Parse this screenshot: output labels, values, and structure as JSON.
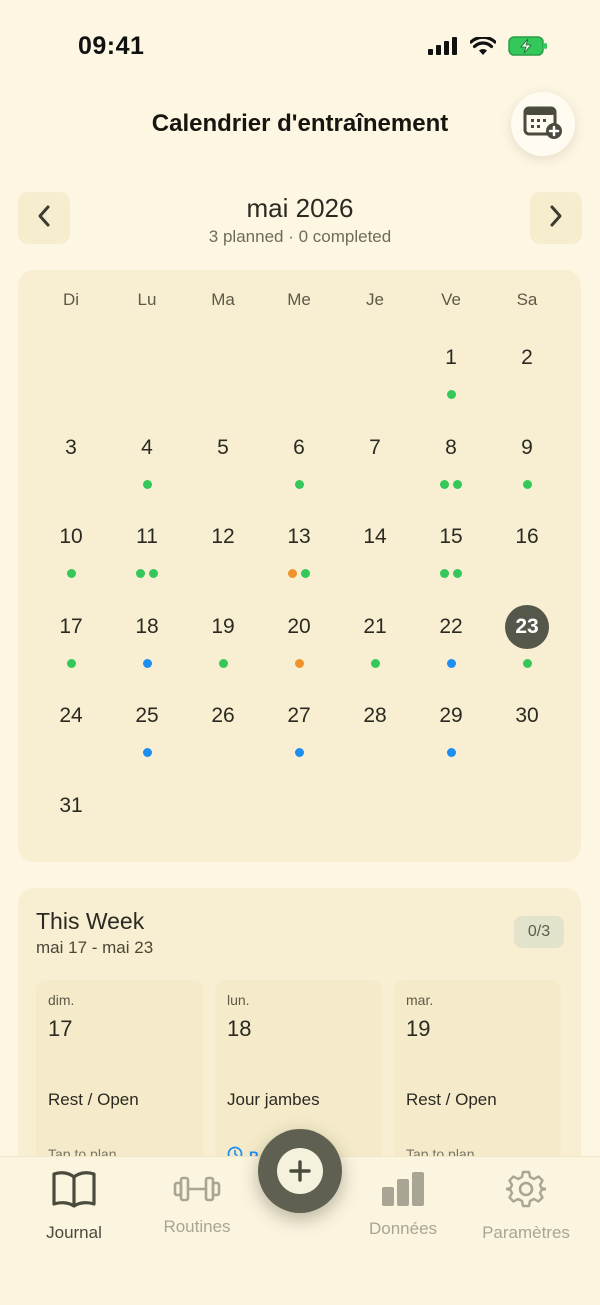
{
  "status_bar": {
    "time": "09:41"
  },
  "header": {
    "title": "Calendrier d'entraînement"
  },
  "month": {
    "title": "mai 2026",
    "subtitle": "3 planned · 0 completed"
  },
  "calendar": {
    "weekdays": [
      "Di",
      "Lu",
      "Ma",
      "Me",
      "Je",
      "Ve",
      "Sa"
    ],
    "today": "23",
    "weeks": [
      [
        null,
        null,
        null,
        null,
        null,
        {
          "day": "1",
          "dots": [
            "green"
          ]
        },
        {
          "day": "2",
          "dots": []
        }
      ],
      [
        {
          "day": "3",
          "dots": []
        },
        {
          "day": "4",
          "dots": [
            "green"
          ]
        },
        {
          "day": "5",
          "dots": []
        },
        {
          "day": "6",
          "dots": [
            "green"
          ]
        },
        {
          "day": "7",
          "dots": []
        },
        {
          "day": "8",
          "dots": [
            "green",
            "green"
          ]
        },
        {
          "day": "9",
          "dots": [
            "green"
          ]
        }
      ],
      [
        {
          "day": "10",
          "dots": [
            "green"
          ]
        },
        {
          "day": "11",
          "dots": [
            "green",
            "green"
          ]
        },
        {
          "day": "12",
          "dots": []
        },
        {
          "day": "13",
          "dots": [
            "orange",
            "green"
          ]
        },
        {
          "day": "14",
          "dots": []
        },
        {
          "day": "15",
          "dots": [
            "green",
            "green"
          ]
        },
        {
          "day": "16",
          "dots": []
        }
      ],
      [
        {
          "day": "17",
          "dots": [
            "green"
          ]
        },
        {
          "day": "18",
          "dots": [
            "blue"
          ]
        },
        {
          "day": "19",
          "dots": [
            "green"
          ]
        },
        {
          "day": "20",
          "dots": [
            "orange"
          ]
        },
        {
          "day": "21",
          "dots": [
            "green"
          ]
        },
        {
          "day": "22",
          "dots": [
            "blue"
          ]
        },
        {
          "day": "23",
          "dots": [
            "green"
          ]
        }
      ],
      [
        {
          "day": "24",
          "dots": []
        },
        {
          "day": "25",
          "dots": [
            "blue"
          ]
        },
        {
          "day": "26",
          "dots": []
        },
        {
          "day": "27",
          "dots": [
            "blue"
          ]
        },
        {
          "day": "28",
          "dots": []
        },
        {
          "day": "29",
          "dots": [
            "blue"
          ]
        },
        {
          "day": "30",
          "dots": []
        }
      ],
      [
        {
          "day": "31",
          "dots": []
        },
        null,
        null,
        null,
        null,
        null,
        null
      ]
    ]
  },
  "colors": {
    "green": "#34c759",
    "orange": "#f0932b",
    "blue": "#1e8ff0",
    "today_bg": "#55574a",
    "background": "#fdf6e3",
    "card": "#f8efd2"
  },
  "this_week": {
    "title": "This Week",
    "range": "mai 17 - mai 23",
    "badge": "0/3",
    "days": [
      {
        "name": "dim.",
        "num": "17",
        "label": "Rest / Open",
        "hint": "Tap to plan"
      },
      {
        "name": "lun.",
        "num": "18",
        "label": "Jour jambes",
        "hint": "P"
      },
      {
        "name": "mar.",
        "num": "19",
        "label": "Rest / Open",
        "hint": "Tap to plan"
      }
    ]
  },
  "tab_bar": {
    "tabs": [
      {
        "label": "Journal",
        "icon": "book-icon",
        "active": true
      },
      {
        "label": "Routines",
        "icon": "dumbbell-icon",
        "active": false
      },
      {
        "label": "Données",
        "icon": "bar-chart-icon",
        "active": false
      },
      {
        "label": "Paramètres",
        "icon": "gear-icon",
        "active": false
      }
    ],
    "fab_icon": "plus-icon"
  }
}
